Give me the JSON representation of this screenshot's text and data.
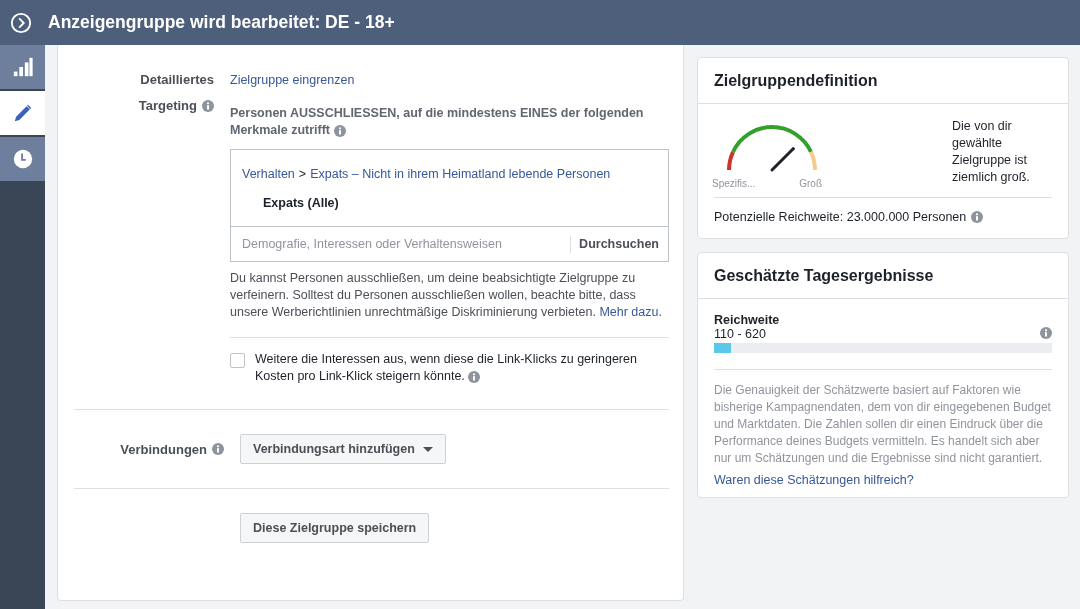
{
  "header": {
    "title": "Anzeigengruppe wird bearbeitet: DE - 18+"
  },
  "sidebar": {
    "items": [
      {
        "kind": "chart",
        "selected": false
      },
      {
        "kind": "edit",
        "selected": true
      },
      {
        "kind": "clock",
        "selected": false
      }
    ]
  },
  "targeting": {
    "label_line_1": "Detailliertes",
    "label_line_2": "Targeting",
    "narrow_link": "Zielgruppe eingrenzen",
    "exclude_heading": "Personen AUSSCHLIESSEN, auf die mindestens EINES der folgenden Merkmale zutrifft",
    "breadcrumb": [
      "Verhalten",
      "Expats – Nicht in ihrem Heimatland lebende Personen"
    ],
    "breadcrumb_separator": ">",
    "selected_item": "Expats (Alle)",
    "search": {
      "placeholder": "Demografie, Interessen oder Verhaltensweisen",
      "browse": "Durchsuchen"
    },
    "note": "Du kannst Personen ausschließen, um deine beabsichtigte Zielgruppe zu verfeinern. Solltest du Personen ausschließen wollen, beachte bitte, dass unsere Werberichtlinien unrechtmäßige Diskriminierung verbieten.",
    "note_link": "Mehr dazu.",
    "expand_option": {
      "label": "Weitere die Interessen aus, wenn diese die Link-Klicks zu geringeren Kosten pro Link-Klick steigern könnte.",
      "checked": false
    }
  },
  "connections": {
    "label": "Verbindungen",
    "button": "Verbindungsart hinzufügen"
  },
  "save_button": "Diese Zielgruppe speichern",
  "audience_definition": {
    "title": "Zielgruppendefinition",
    "gauge": {
      "level": 0.75,
      "min_label": "Spezifis...",
      "max_label": "Groß"
    },
    "description": "Die von dir gewählte Zielgruppe ist ziemlich groß.",
    "potential_reach": "Potenzielle Reichweite: 23.000.000 Personen"
  },
  "daily_results": {
    "title": "Geschätzte Tagesergebnisse",
    "metric": "Reichweite",
    "range": "110 - 620",
    "level": 0.05,
    "disclaimer": "Die Genauigkeit der Schätzwerte basiert auf Faktoren wie bisherige Kampagnendaten, dem von dir eingegebenen Budget und Marktdaten. Die Zahlen sollen dir einen Eindruck über die Performance deines Budgets vermitteln. Es handelt sich aber nur um Schätzungen und die Ergebnisse sind nicht garantiert.",
    "feedback_link": "Waren diese Schätzungen hilfreich?"
  }
}
